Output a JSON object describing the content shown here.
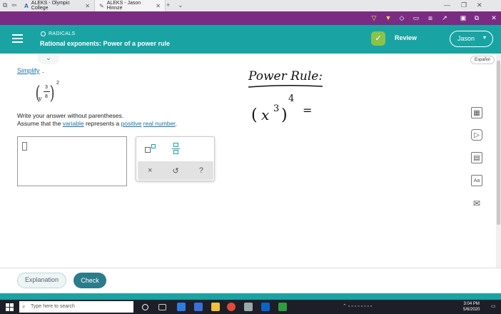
{
  "browser": {
    "tabs": [
      {
        "label": "ALEKS - Olympic College",
        "active": false
      },
      {
        "label": "ALEKS - Jason Hinnze",
        "active": true
      }
    ],
    "new_tab": "+",
    "tab_list": "⌄",
    "window_controls": [
      "—",
      "❐",
      "✕"
    ]
  },
  "header": {
    "topic": "RADICALS",
    "title": "Rational exponents: Power of a power rule",
    "review_label": "Review",
    "user_name": "Jason"
  },
  "language_button": "Español",
  "problem": {
    "simplify": "Simplify",
    "period": ".",
    "numerator": "3",
    "denominator": "8",
    "radicand": "v",
    "outer_exponent": "2",
    "instruction_1": "Write your answer without parentheses.",
    "instruction_2_a": "Assume that the ",
    "instruction_2_link1": "variable",
    "instruction_2_b": " represents a ",
    "instruction_2_link2": "positive",
    "instruction_2_c": " ",
    "instruction_2_link3": "real number",
    "instruction_2_d": "."
  },
  "annotation": {
    "heading": "Power Rule:",
    "base": "x",
    "inner_exp": "3",
    "outer_exp": "4",
    "equals": "="
  },
  "keypad": {
    "clear": "×",
    "undo": "↺",
    "help": "?"
  },
  "footer": {
    "explanation_label": "Explanation",
    "check_label": "Check"
  },
  "taskbar": {
    "search_placeholder": "Type here to search",
    "time": "3:04 PM",
    "date": "5/6/2020"
  },
  "colors": {
    "teal": "#1aa3a3",
    "purple_toolbar": "#7a2c83",
    "link_blue": "#1a73a8",
    "check_button": "#2b7c8a"
  }
}
